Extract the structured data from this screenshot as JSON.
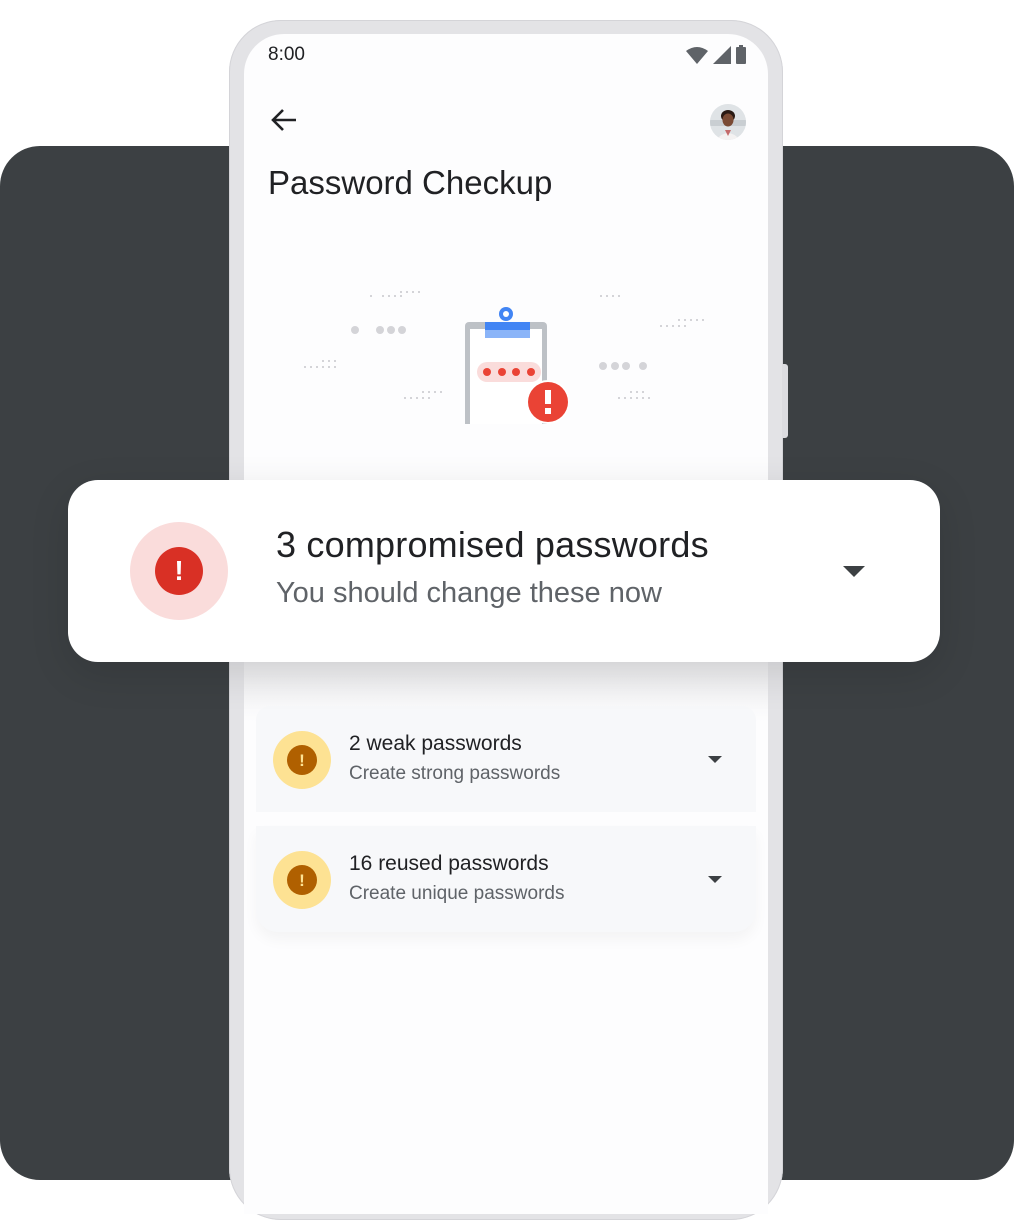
{
  "status_bar": {
    "time": "8:00",
    "icons": [
      "wifi-icon",
      "cellular-signal-icon",
      "battery-icon"
    ]
  },
  "app_bar": {
    "back_icon": "arrow-left-icon",
    "avatar": "account-avatar"
  },
  "page": {
    "title": "Password Checkup"
  },
  "illustration": {
    "name": "clipboard-password-alert-illustration",
    "masked_password_dots": 4
  },
  "colors": {
    "backdrop": "#3c4043",
    "alert_red": "#d93025",
    "alert_red_bg": "#fadcdb",
    "warning_amber": "#b06000",
    "warning_amber_bg": "#fde293",
    "clipboard_blue": "#4285f4"
  },
  "issues": {
    "compromised": {
      "title": "3 compromised passwords",
      "subtitle": "You should change these now",
      "icon": "error-icon",
      "severity": "critical"
    },
    "items": [
      {
        "title": "2 weak passwords",
        "subtitle": "Create strong passwords",
        "icon": "warning-icon",
        "severity": "warning"
      },
      {
        "title": "16 reused passwords",
        "subtitle": "Create unique passwords",
        "icon": "warning-icon",
        "severity": "warning"
      }
    ]
  }
}
